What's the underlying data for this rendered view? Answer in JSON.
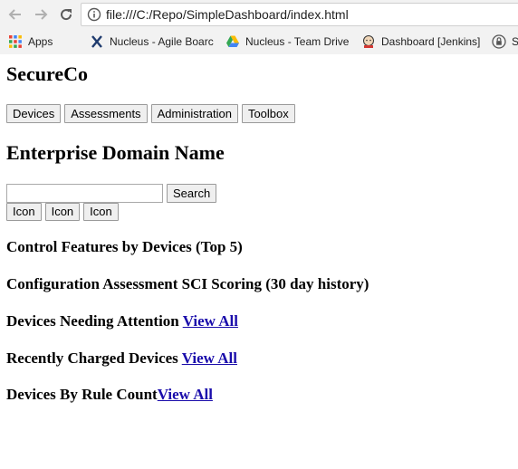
{
  "browser": {
    "url": "file:///C:/Repo/SimpleDashboard/index.html",
    "bookmarks": [
      {
        "label": "Apps",
        "icon": "apps-grid-icon"
      },
      {
        "label": "Nucleus - Agile Boarc",
        "icon": "nucleus-icon"
      },
      {
        "label": "Nucleus - Team Drive",
        "icon": "drive-icon"
      },
      {
        "label": "Dashboard [Jenkins]",
        "icon": "jenkins-icon"
      },
      {
        "label": "S",
        "icon": "lock-circle-icon"
      }
    ]
  },
  "page": {
    "title": "SecureCo",
    "nav_buttons": [
      "Devices",
      "Assessments",
      "Administration",
      "Toolbox"
    ],
    "domain_heading": "Enterprise Domain Name",
    "search": {
      "value": "",
      "button_label": "Search"
    },
    "icon_buttons": [
      "Icon",
      "Icon",
      "Icon"
    ],
    "sections": [
      {
        "heading": "Control Features by Devices (Top 5)",
        "link": ""
      },
      {
        "heading": "Configuration Assessment SCI Scoring (30 day history)",
        "link": ""
      },
      {
        "heading": "Devices Needing Attention ",
        "link": "View All"
      },
      {
        "heading": "Recently Charged Devices ",
        "link": "View All"
      },
      {
        "heading": "Devices By Rule Count",
        "link": "View All"
      }
    ]
  }
}
